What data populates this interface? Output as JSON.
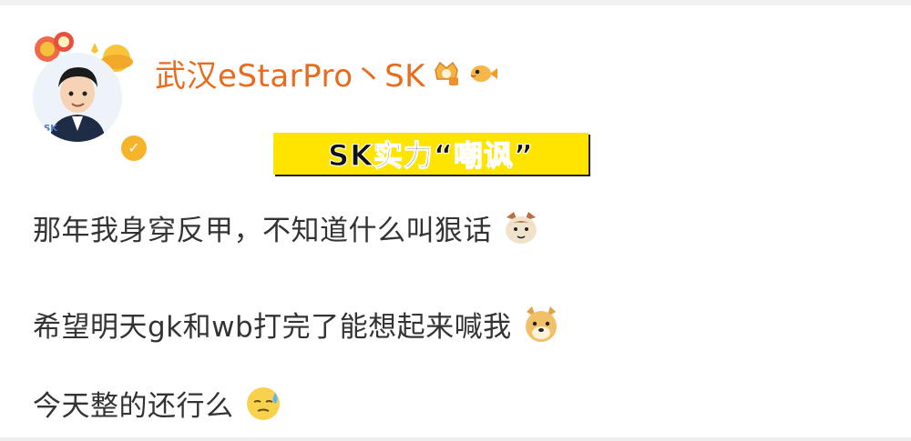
{
  "header": {
    "username": "武汉eStarPro丶SK",
    "avatar_caption": "SK"
  },
  "banner": {
    "text": "SK实力“嘲讽”"
  },
  "post": {
    "lines": [
      "那年我身穿反甲，不知道什么叫狠话",
      "希望明天gk和wb打完了能想起来喊我",
      "今天整的还行么"
    ]
  },
  "colors": {
    "username": "#e86b1e",
    "banner_bg": "#ffe400",
    "text": "#333333",
    "verified": "#f5b42a"
  },
  "icons": [
    "crown-badge-icon",
    "pufferfish-badge-icon",
    "cat-emoji-icon",
    "doge-emoji-icon",
    "sweat-emoji-icon",
    "verified-icon"
  ]
}
